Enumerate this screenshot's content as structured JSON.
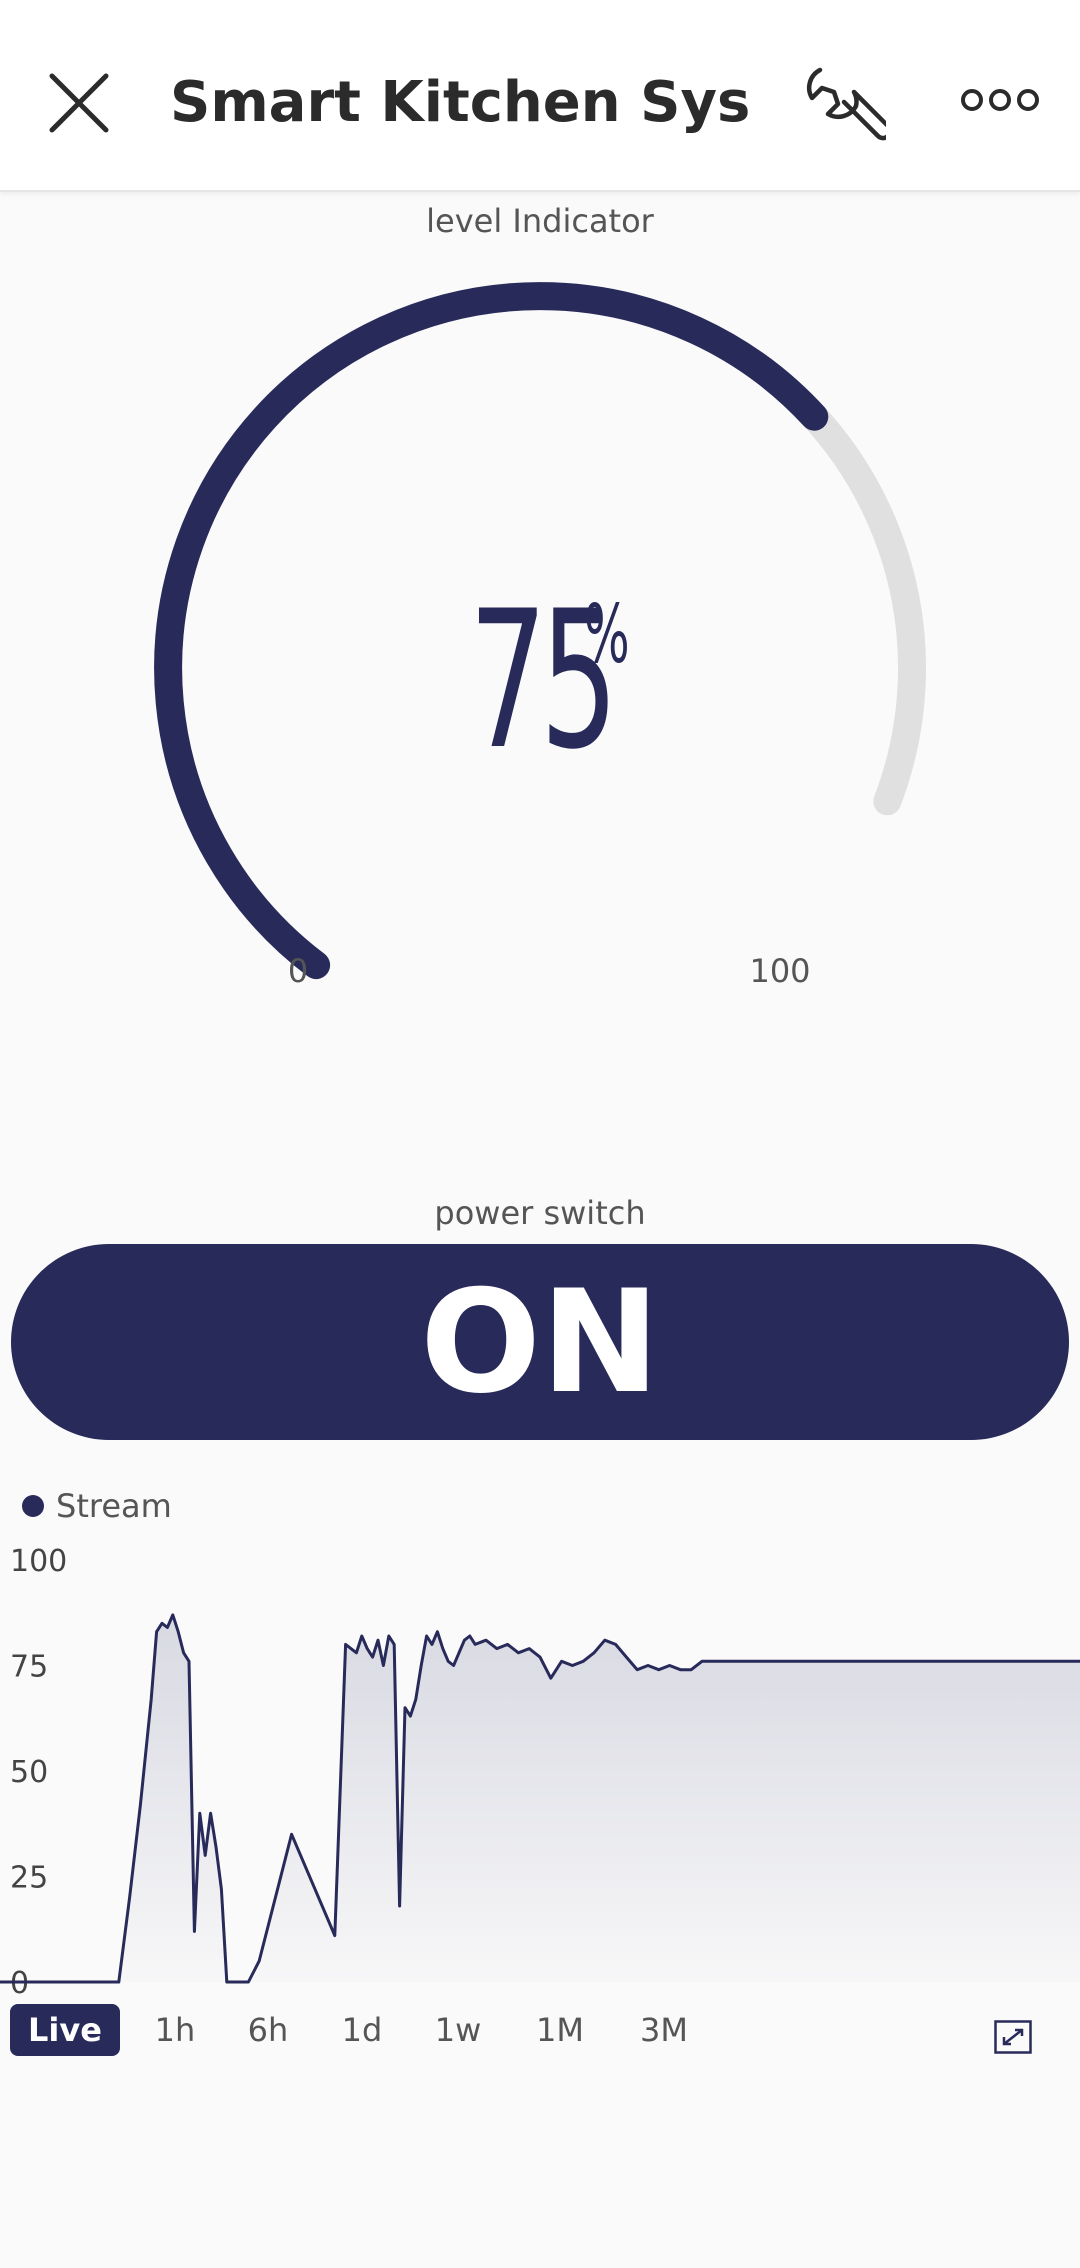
{
  "header": {
    "title": "Smart Kitchen Syste…",
    "close_icon": "close-icon",
    "settings_icon": "wrench-icon",
    "more_icon": "more-dots-icon"
  },
  "gauge": {
    "label": "level Indicator",
    "value": "75",
    "unit": "%",
    "level": 75,
    "min": "0",
    "max": "100",
    "accent_color": "#282a5a",
    "track_color": "#e0e0e0"
  },
  "power_switch": {
    "label": "power switch",
    "state": "ON",
    "on_color": "#282a5a"
  },
  "chart": {
    "legend": "Stream",
    "range_buttons": [
      "Live",
      "1h",
      "6h",
      "1d",
      "1w",
      "1M",
      "3M"
    ],
    "active_range": "Live",
    "expand_icon": "expand-icon"
  },
  "chart_data": {
    "type": "area",
    "series": [
      {
        "name": "Stream"
      }
    ],
    "ylim": [
      0,
      100
    ],
    "yticks": [
      "100",
      "75",
      "50",
      "25",
      "0"
    ],
    "grid": false,
    "legend_position": "top-left",
    "x": [
      0,
      3,
      11,
      12,
      13,
      14,
      14.5,
      15,
      15.5,
      16,
      16.5,
      17,
      17.5,
      18,
      18.5,
      19,
      19.5,
      20,
      20.5,
      21,
      21.5,
      22,
      22.5,
      23,
      24,
      26,
      27,
      31,
      32,
      33,
      33.5,
      34,
      34.5,
      35,
      35.5,
      36,
      36.5,
      37,
      37.5,
      38,
      38.5,
      39,
      39.5,
      40,
      40.5,
      41,
      41.5,
      42,
      42.5,
      43,
      43.5,
      44,
      45,
      46,
      47,
      48,
      49,
      50,
      51,
      52,
      53,
      54,
      55,
      56,
      57,
      58,
      59,
      60,
      61,
      62,
      63,
      64,
      65,
      100
    ],
    "values": [
      0,
      0,
      0,
      20,
      42,
      67,
      83,
      85,
      84,
      87,
      83,
      78,
      76,
      12,
      40,
      30,
      40,
      32,
      22,
      0,
      0,
      0,
      0,
      0,
      5,
      25,
      35,
      11,
      80,
      78,
      82,
      79,
      77,
      81,
      75,
      82,
      80,
      18,
      65,
      63,
      67,
      75,
      82,
      80,
      83,
      79,
      76,
      75,
      78,
      81,
      82,
      80,
      81,
      79,
      80,
      78,
      79,
      77,
      72,
      76,
      75,
      76,
      78,
      81,
      80,
      77,
      74,
      75,
      74,
      75,
      74,
      74,
      76,
      76
    ]
  }
}
